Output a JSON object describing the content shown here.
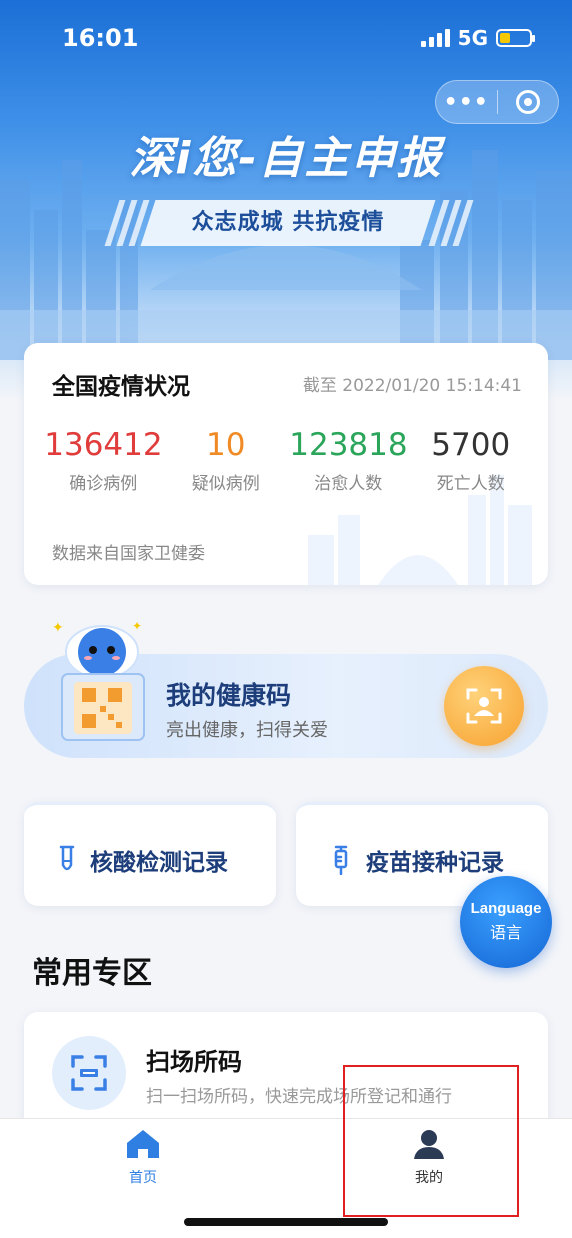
{
  "status_bar": {
    "time": "16:01",
    "network": "5G"
  },
  "capsule": {
    "more_label": "•••"
  },
  "banner": {
    "title": "深i您-自主申报",
    "subtitle": "众志成城  共抗疫情"
  },
  "stats": {
    "title": "全国疫情状况",
    "as_of": "截至 2022/01/20 15:14:41",
    "items": [
      {
        "value": "136412",
        "label": "确诊病例",
        "color": "#e03c3c"
      },
      {
        "value": "10",
        "label": "疑似病例",
        "color": "#f08a24"
      },
      {
        "value": "123818",
        "label": "治愈人数",
        "color": "#2aa55a"
      },
      {
        "value": "5700",
        "label": "死亡人数",
        "color": "#333333"
      }
    ],
    "source": "数据来自国家卫健委"
  },
  "health_code": {
    "title": "我的健康码",
    "subtitle": "亮出健康，扫得关爱"
  },
  "records": {
    "nucleic": "核酸检测记录",
    "vaccine": "疫苗接种记录"
  },
  "language_button": {
    "en": "Language",
    "zh": "语言"
  },
  "section": {
    "title": "常用专区"
  },
  "scan": {
    "title": "扫场所码",
    "subtitle": "扫一扫场所码，快速完成场所登记和通行"
  },
  "tabbar": {
    "home": "首页",
    "mine": "我的"
  },
  "colors": {
    "primary": "#2f7fe3",
    "highlight": "#e02020"
  }
}
